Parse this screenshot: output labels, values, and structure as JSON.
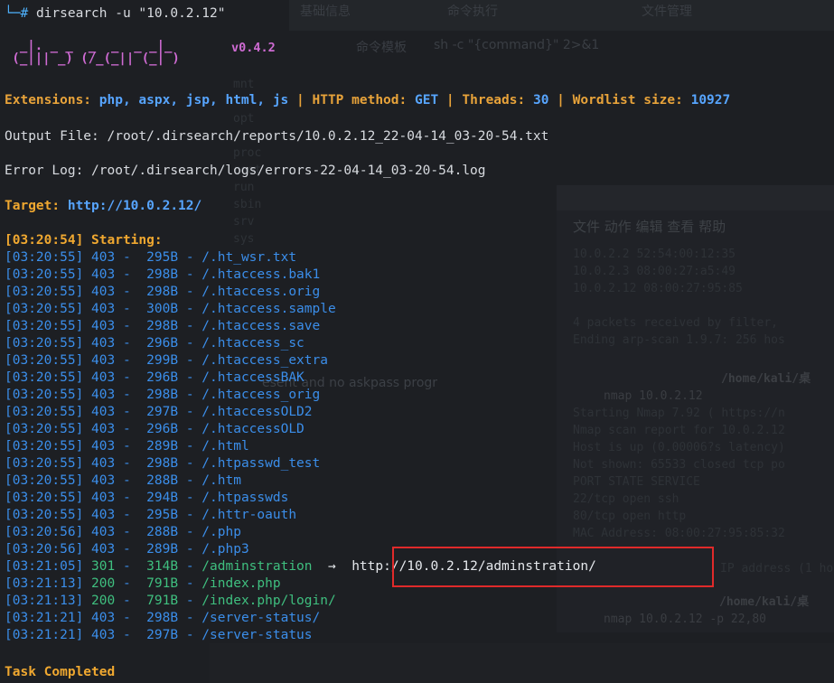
{
  "command_line": {
    "prompt": "└─#",
    "command": "dirsearch -u \"10.0.2.12\""
  },
  "banner": {
    "art_line1": "  _|. _ _  _  _  _ _|_  ",
    "art_line2": " (_||| _) (/_(_|| (_| )  ",
    "version": "v0.4.2"
  },
  "config": {
    "extensions_label": "Extensions:",
    "extensions_value": "php, aspx, jsp, html, js",
    "method_label": "HTTP method:",
    "method_value": "GET",
    "threads_label": "Threads:",
    "threads_value": "30",
    "wordlist_label": "Wordlist size:",
    "wordlist_value": "10927",
    "separator": " | "
  },
  "output_file": "Output File: /root/.dirsearch/reports/10.0.2.12_22-04-14_03-20-54.txt",
  "error_log": "Error Log: /root/.dirsearch/logs/errors-22-04-14_03-20-54.log",
  "target": {
    "label": "Target:",
    "value": "http://10.0.2.12/"
  },
  "starting": "[03:20:54] Starting:",
  "results": [
    {
      "time": "[03:20:55]",
      "code": "403",
      "size": "295B",
      "path": "/.ht_wsr.txt"
    },
    {
      "time": "[03:20:55]",
      "code": "403",
      "size": "298B",
      "path": "/.htaccess.bak1"
    },
    {
      "time": "[03:20:55]",
      "code": "403",
      "size": "298B",
      "path": "/.htaccess.orig"
    },
    {
      "time": "[03:20:55]",
      "code": "403",
      "size": "300B",
      "path": "/.htaccess.sample"
    },
    {
      "time": "[03:20:55]",
      "code": "403",
      "size": "298B",
      "path": "/.htaccess.save"
    },
    {
      "time": "[03:20:55]",
      "code": "403",
      "size": "296B",
      "path": "/.htaccess_sc"
    },
    {
      "time": "[03:20:55]",
      "code": "403",
      "size": "299B",
      "path": "/.htaccess_extra"
    },
    {
      "time": "[03:20:55]",
      "code": "403",
      "size": "296B",
      "path": "/.htaccessBAK"
    },
    {
      "time": "[03:20:55]",
      "code": "403",
      "size": "298B",
      "path": "/.htaccess_orig"
    },
    {
      "time": "[03:20:55]",
      "code": "403",
      "size": "297B",
      "path": "/.htaccessOLD2"
    },
    {
      "time": "[03:20:55]",
      "code": "403",
      "size": "296B",
      "path": "/.htaccessOLD"
    },
    {
      "time": "[03:20:55]",
      "code": "403",
      "size": "289B",
      "path": "/.html"
    },
    {
      "time": "[03:20:55]",
      "code": "403",
      "size": "298B",
      "path": "/.htpasswd_test"
    },
    {
      "time": "[03:20:55]",
      "code": "403",
      "size": "288B",
      "path": "/.htm"
    },
    {
      "time": "[03:20:55]",
      "code": "403",
      "size": "294B",
      "path": "/.htpasswds"
    },
    {
      "time": "[03:20:55]",
      "code": "403",
      "size": "295B",
      "path": "/.httr-oauth"
    },
    {
      "time": "[03:20:56]",
      "code": "403",
      "size": "288B",
      "path": "/.php"
    },
    {
      "time": "[03:20:56]",
      "code": "403",
      "size": "289B",
      "path": "/.php3"
    },
    {
      "time": "[03:21:05]",
      "code": "301",
      "size": "314B",
      "path": "/adminstration",
      "arrow": "→",
      "redirect": "http://10.0.2.12/adminstration/"
    },
    {
      "time": "[03:21:13]",
      "code": "200",
      "size": "791B",
      "path": "/index.php"
    },
    {
      "time": "[03:21:13]",
      "code": "200",
      "size": "791B",
      "path": "/index.php/login/"
    },
    {
      "time": "[03:21:21]",
      "code": "403",
      "size": "298B",
      "path": "/server-status/"
    },
    {
      "time": "[03:21:21]",
      "code": "403",
      "size": "297B",
      "path": "/server-status"
    }
  ],
  "task_completed": "Task Completed",
  "background": {
    "tab_basic": "基础信息",
    "tab_exec": "命令执行",
    "tab_files": "文件管理",
    "cmd_template_label": "命令模板",
    "cmd_template_value": "sh -c \"{command}\" 2>&1",
    "menu": "文件  动作  编辑  查看  帮助",
    "arp_lines": [
      "10.0.2.2        52:54:00:12:35",
      "10.0.2.3        08:00:27:a5:49",
      "10.0.2.12       08:00:27:95:85"
    ],
    "arp_footer1": "4 packets received by filter, ",
    "arp_footer2": "Ending arp-scan 1.9.7: 256 hos",
    "home_path": "/home/kali/桌",
    "nmap_cmd": "nmap 10.0.2.12",
    "nmap_lines": [
      "Starting Nmap 7.92 ( https://n",
      "Nmap scan report for 10.0.2.12",
      "Host is up (0.00006?s latency)",
      "Not shown: 65533 closed tcp po",
      "PORT   STATE SERVICE",
      "22/tcp open  ssh",
      "80/tcp open  http",
      "MAC Address: 08:00:27:95:85:32"
    ],
    "ip_address_text": "IP address (1 hos",
    "home_path2": "/home/kali/桌",
    "nmap_cmd2": "nmap 10.0.2.12 -p 22,80",
    "askpass_text": "esent and no askpass progr",
    "sidebar_items": [
      "mnt",
      "opt",
      "proc",
      "root",
      "run",
      "sbin",
      "srv",
      "sys"
    ]
  }
}
